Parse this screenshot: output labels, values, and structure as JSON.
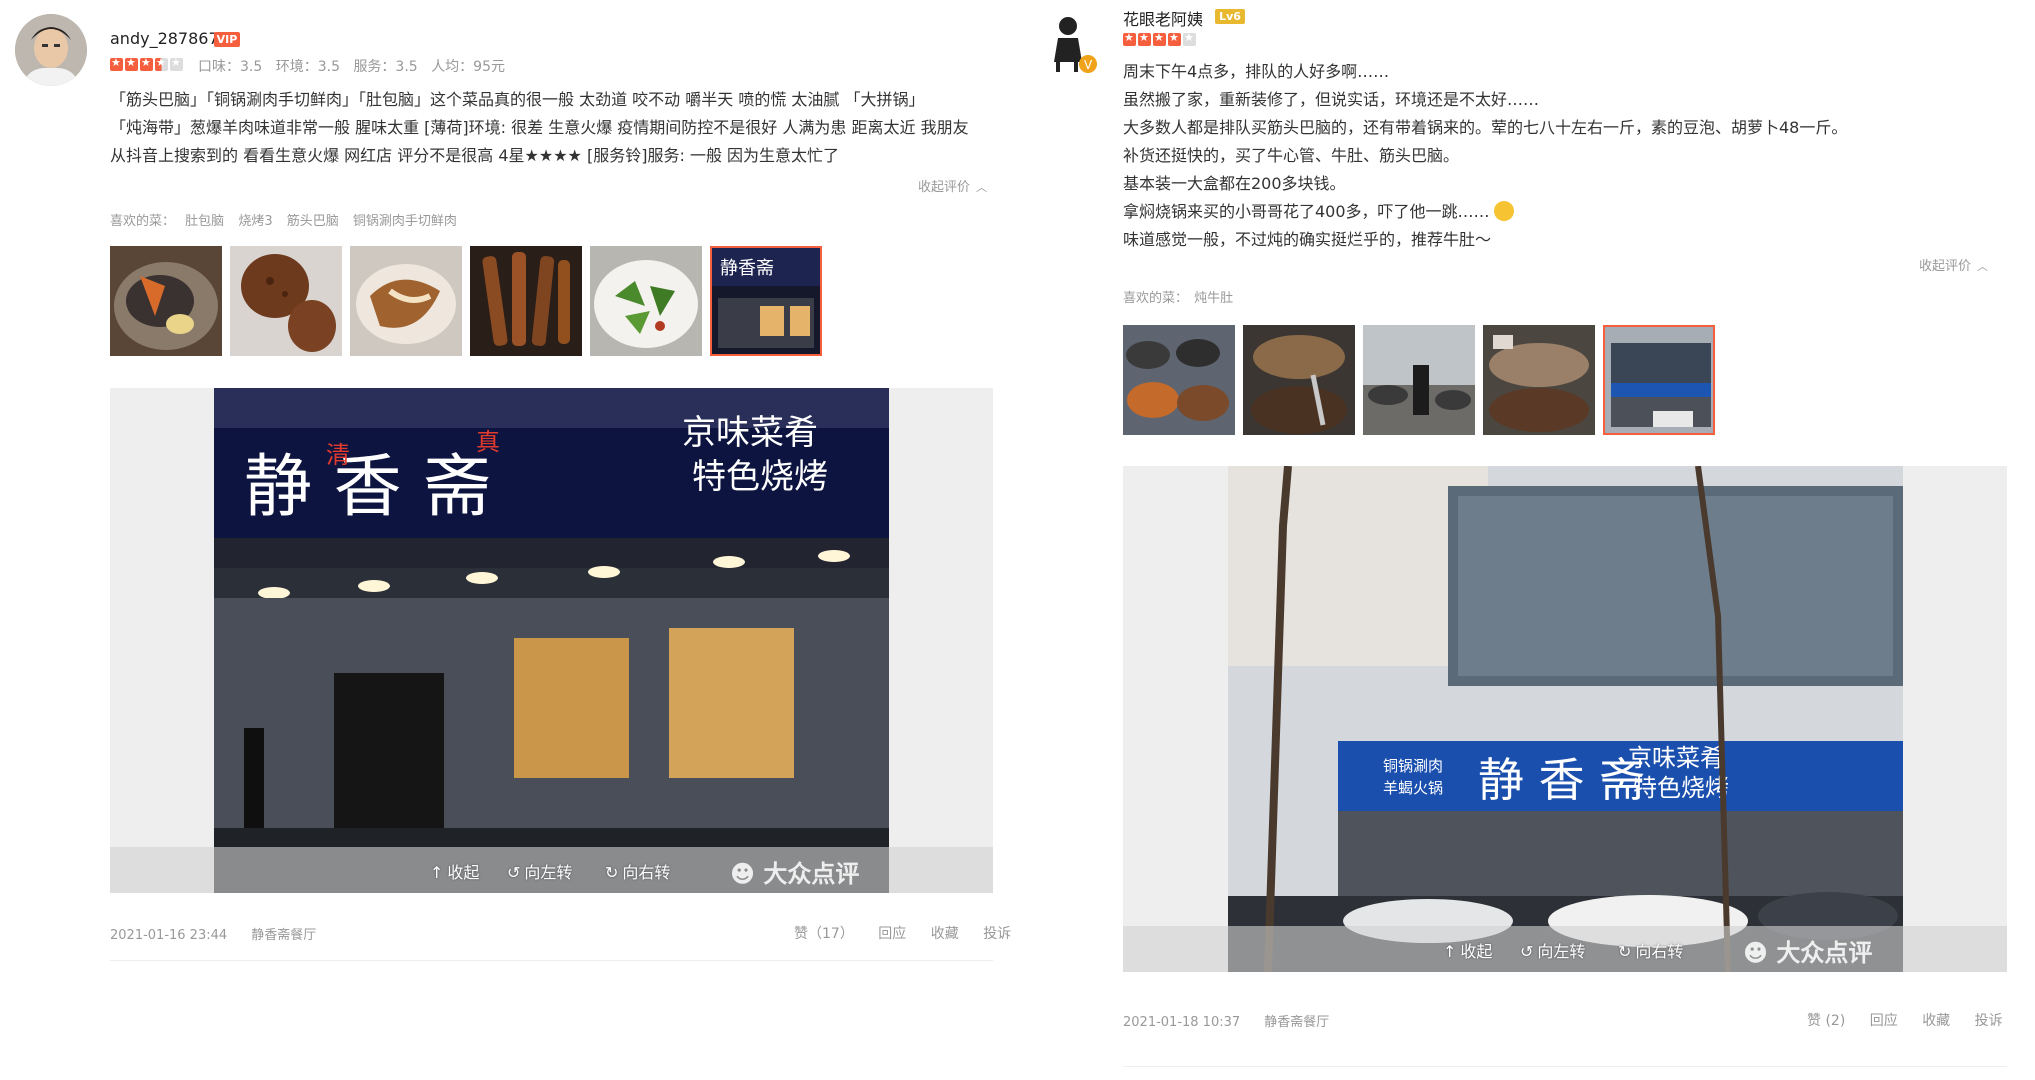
{
  "left_review": {
    "username": "andy_287867",
    "badge": "VIP",
    "scores": [
      "口味：3.5",
      "环境：3.5",
      "服务：3.5",
      "人均：95元"
    ],
    "rating": 3.5,
    "text_lines": [
      "「筋头巴脑」「铜锅涮肉手切鲜肉」「肚包脑」这个菜品真的很一般 太劲道 咬不动 嚼半天 喷的慌 太油腻 「大拼锅」",
      "「炖海带」葱爆羊肉味道非常一般 腥味太重 [薄荷]环境: 很差 生意火爆 疫情期间防控不是很好 人满为患 距离太近 我朋友",
      "从抖音上搜索到的 看看生意火爆 网红店 评分不是很高 4星★★★★ [服务铃]服务: 一般 因为生意太忙了"
    ],
    "collapse_label": "收起评价",
    "fav_label": "喜欢的菜：",
    "fav_dishes": [
      "肚包脑",
      "烧烤3",
      "筋头巴脑",
      "铜锅涮肉手切鲜肉"
    ],
    "viewer": {
      "collapse": "收起",
      "rotate_left": "向左转",
      "rotate_right": "向右转",
      "watermark": "大众点评"
    },
    "sign": {
      "main": "静 香 斋",
      "small_1": "清",
      "small_2": "真",
      "side_1": "京味菜肴",
      "side_2": "特色烧烤"
    },
    "date": "2021-01-16 23:44",
    "shop": "静香斋餐厅",
    "like": "赞（17）",
    "reply": "回应",
    "favorite": "收藏",
    "report": "投诉"
  },
  "right_review": {
    "username": "花眼老阿姨",
    "badge": "Lv6",
    "rating": 4,
    "text_lines": [
      "周末下午4点多，排队的人好多啊……",
      "虽然搬了家，重新装修了，但说实话，环境还是不太好……",
      "大多数人都是排队买筋头巴脑的，还有带着锅来的。荤的七八十左右一斤，素的豆泡、胡萝卜48一斤。",
      "补货还挺快的，买了牛心管、牛肚、筋头巴脑。",
      "基本装一大盒都在200多块钱。",
      "拿焖烧锅来买的小哥哥花了400多，吓了他一跳……",
      "味道感觉一般，不过炖的确实挺烂乎的，推荐牛肚～"
    ],
    "collapse_label": "收起评价",
    "fav_label": "喜欢的菜：",
    "fav_dishes": [
      "炖牛肚"
    ],
    "viewer": {
      "collapse": "收起",
      "rotate_left": "向左转",
      "rotate_right": "向右转",
      "watermark": "大众点评"
    },
    "sign": {
      "main": "静 香 斋",
      "left_1": "铜锅涮肉",
      "left_2": "羊蝎火锅",
      "side_1": "京味菜肴",
      "side_2": "特色烧烤"
    },
    "date": "2021-01-18 10:37",
    "shop": "静香斋餐厅",
    "like": "赞 (2)",
    "reply": "回应",
    "favorite": "收藏",
    "report": "投诉"
  },
  "colors": {
    "accent": "#f55f3e",
    "vip": "#f55f3e",
    "lv6": "#e8b92e",
    "muted": "#999999"
  }
}
